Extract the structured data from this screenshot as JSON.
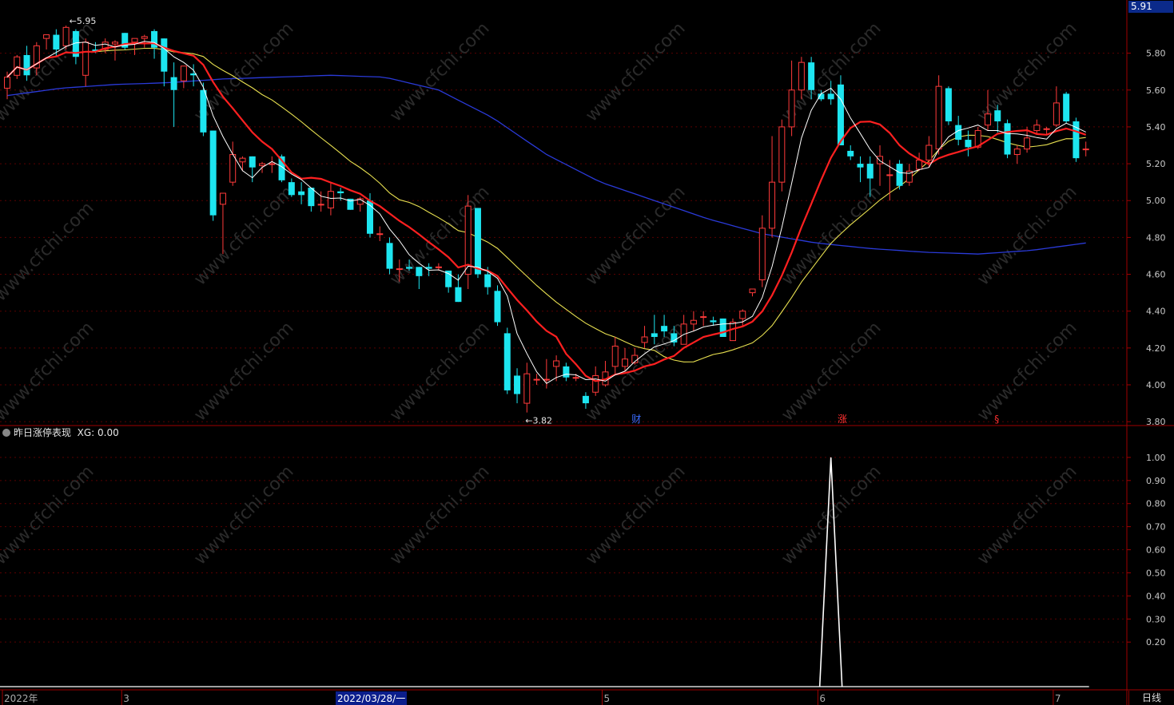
{
  "chart_data": {
    "type": "candlestick",
    "main_panel": {
      "ylim": [
        3.74,
        5.95
      ],
      "y_ticks": [
        "5.80",
        "5.60",
        "5.40",
        "5.20",
        "5.00",
        "4.80",
        "4.60",
        "4.40",
        "4.20",
        "4.00",
        "3.80"
      ],
      "current_price": "5.91",
      "high_label": "5.95",
      "low_label": "3.82",
      "event_marks": [
        {
          "text": "财",
          "color": "#3a6cff",
          "bar": 64
        },
        {
          "text": "涨",
          "color": "#ff3030",
          "bar": 85
        },
        {
          "text": "§",
          "color": "#ff3030",
          "bar": 101
        }
      ],
      "candles": [
        [
          5.61,
          5.67,
          5.55,
          5.7
        ],
        [
          5.68,
          5.78,
          5.66,
          5.79
        ],
        [
          5.79,
          5.68,
          5.65,
          5.84
        ],
        [
          5.72,
          5.84,
          5.68,
          5.86
        ],
        [
          5.88,
          5.9,
          5.82,
          5.9
        ],
        [
          5.9,
          5.82,
          5.78,
          5.93
        ],
        [
          5.84,
          5.94,
          5.82,
          5.95
        ],
        [
          5.92,
          5.78,
          5.74,
          5.93
        ],
        [
          5.68,
          5.86,
          5.62,
          5.88
        ],
        [
          5.82,
          5.81,
          5.8,
          5.86
        ],
        [
          5.82,
          5.86,
          5.8,
          5.88
        ],
        [
          5.85,
          5.86,
          5.76,
          5.87
        ],
        [
          5.91,
          5.83,
          5.82,
          5.91
        ],
        [
          5.86,
          5.88,
          5.79,
          5.88
        ],
        [
          5.88,
          5.89,
          5.83,
          5.9
        ],
        [
          5.92,
          5.83,
          5.77,
          5.93
        ],
        [
          5.88,
          5.7,
          5.62,
          5.88
        ],
        [
          5.67,
          5.6,
          5.4,
          5.75
        ],
        [
          5.65,
          5.73,
          5.61,
          5.73
        ],
        [
          5.69,
          5.68,
          5.62,
          5.74
        ],
        [
          5.6,
          5.37,
          5.35,
          5.64
        ],
        [
          5.38,
          4.92,
          4.89,
          5.38
        ],
        [
          4.98,
          5.04,
          4.71,
          5.04
        ],
        [
          5.1,
          5.25,
          5.08,
          5.32
        ],
        [
          5.21,
          5.23,
          5.16,
          5.24
        ],
        [
          5.24,
          5.18,
          5.1,
          5.24
        ],
        [
          5.19,
          5.2,
          5.15,
          5.21
        ],
        [
          5.2,
          5.2,
          5.15,
          5.24
        ],
        [
          5.24,
          5.11,
          5.1,
          5.25
        ],
        [
          5.1,
          5.03,
          5.02,
          5.12
        ],
        [
          5.05,
          5.03,
          4.98,
          5.1
        ],
        [
          5.07,
          4.97,
          4.94,
          5.07
        ],
        [
          4.98,
          4.98,
          4.94,
          5.05
        ],
        [
          4.96,
          5.05,
          4.92,
          5.1
        ],
        [
          5.05,
          5.04,
          5.0,
          5.07
        ],
        [
          5.01,
          4.95,
          4.95,
          5.01
        ],
        [
          4.98,
          5.01,
          4.94,
          5.02
        ],
        [
          5.0,
          4.82,
          4.8,
          5.04
        ],
        [
          4.82,
          4.82,
          4.78,
          4.86
        ],
        [
          4.77,
          4.63,
          4.6,
          4.8
        ],
        [
          4.63,
          4.63,
          4.56,
          4.68
        ],
        [
          4.64,
          4.63,
          4.62,
          4.68
        ],
        [
          4.64,
          4.59,
          4.52,
          4.64
        ],
        [
          4.64,
          4.63,
          4.59,
          4.66
        ],
        [
          4.64,
          4.64,
          4.62,
          4.66
        ],
        [
          4.62,
          4.53,
          4.5,
          4.62
        ],
        [
          4.53,
          4.45,
          4.45,
          4.6
        ],
        [
          4.6,
          4.97,
          4.52,
          5.03
        ],
        [
          4.96,
          4.6,
          4.58,
          4.96
        ],
        [
          4.6,
          4.53,
          4.49,
          4.64
        ],
        [
          4.51,
          4.34,
          4.32,
          4.54
        ],
        [
          4.28,
          3.97,
          3.95,
          4.31
        ],
        [
          4.05,
          3.95,
          3.9,
          4.09
        ],
        [
          3.9,
          4.06,
          3.85,
          4.12
        ],
        [
          4.03,
          4.03,
          4.0,
          4.06
        ],
        [
          4.03,
          4.03,
          3.98,
          4.14
        ],
        [
          4.1,
          4.13,
          4.02,
          4.16
        ],
        [
          4.1,
          4.04,
          4.02,
          4.12
        ],
        [
          4.04,
          4.04,
          4.02,
          4.06
        ],
        [
          3.94,
          3.9,
          3.87,
          3.96
        ],
        [
          3.96,
          4.05,
          3.94,
          4.1
        ],
        [
          4.0,
          4.07,
          3.99,
          4.13
        ],
        [
          4.1,
          4.21,
          4.06,
          4.26
        ],
        [
          4.1,
          4.14,
          4.07,
          4.2
        ],
        [
          4.12,
          4.16,
          4.11,
          4.2
        ],
        [
          4.23,
          4.26,
          4.2,
          4.32
        ],
        [
          4.28,
          4.26,
          4.22,
          4.38
        ],
        [
          4.32,
          4.29,
          4.26,
          4.38
        ],
        [
          4.28,
          4.23,
          4.21,
          4.32
        ],
        [
          4.22,
          4.33,
          4.22,
          4.38
        ],
        [
          4.33,
          4.35,
          4.29,
          4.4
        ],
        [
          4.37,
          4.37,
          4.32,
          4.4
        ],
        [
          4.35,
          4.34,
          4.32,
          4.37
        ],
        [
          4.36,
          4.26,
          4.26,
          4.36
        ],
        [
          4.24,
          4.34,
          4.24,
          4.36
        ],
        [
          4.36,
          4.4,
          4.32,
          4.41
        ],
        [
          4.5,
          4.52,
          4.48,
          4.52
        ],
        [
          4.57,
          4.85,
          4.53,
          4.92
        ],
        [
          4.85,
          5.1,
          4.8,
          5.35
        ],
        [
          5.1,
          5.4,
          5.05,
          5.44
        ],
        [
          5.4,
          5.6,
          5.35,
          5.76
        ],
        [
          5.6,
          5.75,
          5.55,
          5.78
        ],
        [
          5.75,
          5.6,
          5.55,
          5.78
        ],
        [
          5.58,
          5.55,
          5.54,
          5.6
        ],
        [
          5.58,
          5.55,
          5.52,
          5.65
        ],
        [
          5.63,
          5.3,
          5.3,
          5.68
        ],
        [
          5.27,
          5.24,
          5.22,
          5.3
        ],
        [
          5.2,
          5.18,
          5.1,
          5.24
        ],
        [
          5.2,
          5.12,
          5.02,
          5.24
        ],
        [
          5.2,
          5.24,
          5.08,
          5.3
        ],
        [
          5.14,
          5.14,
          5.0,
          5.22
        ],
        [
          5.2,
          5.08,
          5.06,
          5.22
        ],
        [
          5.1,
          5.16,
          5.08,
          5.2
        ],
        [
          5.17,
          5.22,
          5.16,
          5.26
        ],
        [
          5.22,
          5.3,
          5.18,
          5.35
        ],
        [
          5.28,
          5.62,
          5.25,
          5.68
        ],
        [
          5.61,
          5.43,
          5.41,
          5.62
        ],
        [
          5.41,
          5.33,
          5.3,
          5.46
        ],
        [
          5.33,
          5.29,
          5.24,
          5.38
        ],
        [
          5.29,
          5.38,
          5.28,
          5.4
        ],
        [
          5.41,
          5.47,
          5.38,
          5.6
        ],
        [
          5.49,
          5.43,
          5.37,
          5.52
        ],
        [
          5.42,
          5.25,
          5.23,
          5.44
        ],
        [
          5.25,
          5.28,
          5.2,
          5.3
        ],
        [
          5.28,
          5.34,
          5.26,
          5.4
        ],
        [
          5.38,
          5.41,
          5.36,
          5.44
        ],
        [
          5.39,
          5.39,
          5.36,
          5.4
        ],
        [
          5.41,
          5.53,
          5.4,
          5.62
        ],
        [
          5.58,
          5.43,
          5.42,
          5.59
        ],
        [
          5.43,
          5.23,
          5.21,
          5.45
        ],
        [
          5.28,
          5.28,
          5.24,
          5.32
        ]
      ],
      "series": [
        {
          "name": "MA5",
          "color": "#ffffff"
        },
        {
          "name": "MA10",
          "color": "#ff2020"
        },
        {
          "name": "MA20",
          "color": "#e8e050"
        },
        {
          "name": "MA60",
          "color": "#2a3ad8"
        }
      ],
      "ma60_overlay": [
        5.57,
        5.61,
        5.63,
        5.64,
        5.66,
        5.67,
        5.68,
        5.67,
        5.6,
        5.45,
        5.25,
        5.1,
        5.0,
        4.9,
        4.82,
        4.77,
        4.74,
        4.72,
        4.71,
        4.73,
        4.77
      ]
    },
    "indicator_panel": {
      "title": "昨日涨停表现",
      "legend": "XG: 0.00",
      "ylim": [
        0,
        1.1
      ],
      "y_ticks": [
        "1.00",
        "0.90",
        "0.80",
        "0.70",
        "0.60",
        "0.50",
        "0.40",
        "0.30",
        "0.20"
      ],
      "spike_bar": 84,
      "spike_value": 1.0
    },
    "x_labels": [
      {
        "text": "2022年",
        "bar": 0
      },
      {
        "text": "3",
        "bar": 12
      },
      {
        "text": "5",
        "bar": 61
      },
      {
        "text": "6",
        "bar": 83
      },
      {
        "text": "7",
        "bar": 107
      }
    ],
    "cursor_date": "2022/03/28/一"
  },
  "ui": {
    "period_label": "日线",
    "watermark": "www.cfchi.com"
  }
}
